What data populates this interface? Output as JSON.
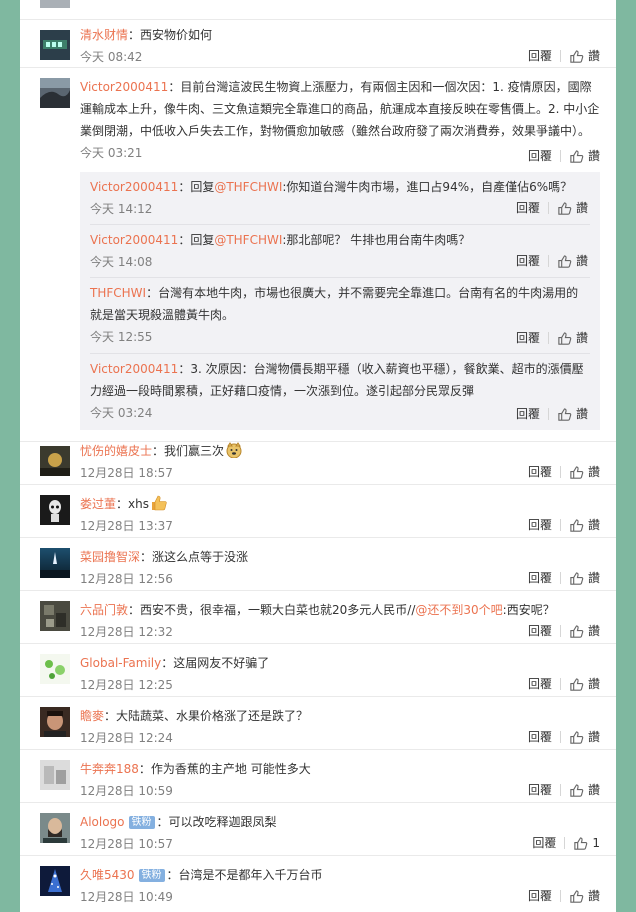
{
  "colors": {
    "page_bg": "#7fb8a0",
    "username": "#eb7350",
    "badge": "#84b0e0",
    "meta": "#808080"
  },
  "labels": {
    "reply": "回覆",
    "like": "讚"
  },
  "comments": [
    {
      "user": "清水财情",
      "text": "：西安物价如何",
      "time": "今天 08:42"
    },
    {
      "user": "Victor2000411",
      "text": "：目前台灣這波民生物資上漲壓力，有兩個主因和一個次因：1. 疫情原因，國際運輸成本上升，像牛肉、三文魚這類完全靠進口的商品，航運成本直接反映在零售價上。2. 中小企業倒閉潮，中低收入戶失去工作，對物價愈加敏感（雖然台政府發了兩次消費券，效果爭議中）。",
      "time": "今天 03:21",
      "replies": [
        {
          "user": "Victor2000411",
          "pre": "：回复",
          "at": "@THFCHWI",
          "text": ":你知道台灣牛肉市場，進口占94%，自產僅佔6%嗎？",
          "time": "今天 14:12"
        },
        {
          "user": "Victor2000411",
          "pre": "：回复",
          "at": "@THFCHWI",
          "text": ":那北部呢？ 牛排也用台南牛肉嗎？",
          "time": "今天 14:08"
        },
        {
          "user": "THFCHWI",
          "pre": "",
          "at": "",
          "text": "：台灣有本地牛肉，市場也很廣大，并不需要完全靠進口。台南有名的牛肉湯用的就是當天現殺溫體黃牛肉。",
          "time": "今天 12:55"
        },
        {
          "user": "Victor2000411",
          "pre": "",
          "at": "",
          "text": "：3. 次原因：台灣物價長期平穩（收入薪資也平穩），餐飲業、超市的漲價壓力經過一段時間累積，正好藉口疫情，一次漲到位。遂引起部分民眾反彈",
          "time": "今天 03:24"
        }
      ]
    },
    {
      "user": "忧伤的嬉皮士",
      "text": "：我们赢三次",
      "emoji": "doge-emoji",
      "time": "12月28日 18:57"
    },
    {
      "user": "娄过董",
      "text": "：xhs",
      "emoji": "thumbs-up-emoji",
      "time": "12月28日 13:37"
    },
    {
      "user": "菜园撸智深",
      "text": "：涨这么点等于没涨",
      "time": "12月28日 12:56"
    },
    {
      "user": "六品门敦",
      "text": "：西安不贵，很幸福，一颗大白菜也就20多元人民币//",
      "at": "@还不到30个吧",
      "text2": ":西安呢？",
      "time": "12月28日 12:32"
    },
    {
      "user": "Global-Family",
      "text": "：这届网友不好骗了",
      "time": "12月28日 12:25"
    },
    {
      "user": "瞻麥",
      "text": "：大陆蔬菜、水果价格涨了还是跌了？",
      "time": "12月28日 12:24"
    },
    {
      "user": "牛奔奔188",
      "text": "：作为香蕉的主产地 可能性多大",
      "time": "12月28日 10:59"
    },
    {
      "user": "Alologo",
      "badge": "铁粉",
      "text": "：可以改吃释迦跟凤梨",
      "time": "12月28日 10:57",
      "likes": "1"
    },
    {
      "user": "久唯5430",
      "badge": "铁粉",
      "text": "：台湾是不是都年入千万台币",
      "time": "12月28日 10:49"
    }
  ]
}
